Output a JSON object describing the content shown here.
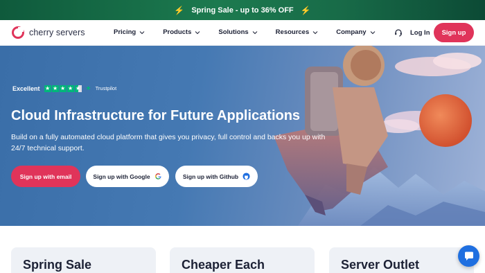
{
  "promo": {
    "text": "Spring Sale - up to 36% OFF",
    "bolt": "⚡"
  },
  "header": {
    "logo_text": "cherry servers",
    "nav": [
      {
        "label": "Pricing"
      },
      {
        "label": "Products"
      },
      {
        "label": "Solutions"
      },
      {
        "label": "Resources"
      },
      {
        "label": "Company"
      }
    ],
    "login_label": "Log In",
    "signup_label": "Sign up"
  },
  "hero": {
    "trust_rating": "Excellent",
    "trust_brand": "Trustpilot",
    "stars_filled": 4.5,
    "title": "Cloud Infrastructure for Future Applications",
    "subtitle": "Build on a fully automated cloud platform that gives you privacy, full control and backs you up with 24/7 technical support.",
    "cta_email": "Sign up with email",
    "cta_google": "Sign up with Google",
    "cta_github": "Sign up with Github"
  },
  "cards": [
    {
      "title": "Spring Sale"
    },
    {
      "title": "Cheaper Each"
    },
    {
      "title": "Server Outlet"
    }
  ],
  "colors": {
    "brand": "#e0345a",
    "promo_bg": "#1c7a4f",
    "hero_bg": "#4579b3",
    "trustpilot": "#00b67a",
    "chat": "#1f6fe0"
  },
  "icons": {
    "logo": "cherry-logo-icon",
    "support": "headset-icon",
    "google": "google-icon",
    "github": "github-icon",
    "chat": "chat-icon"
  }
}
